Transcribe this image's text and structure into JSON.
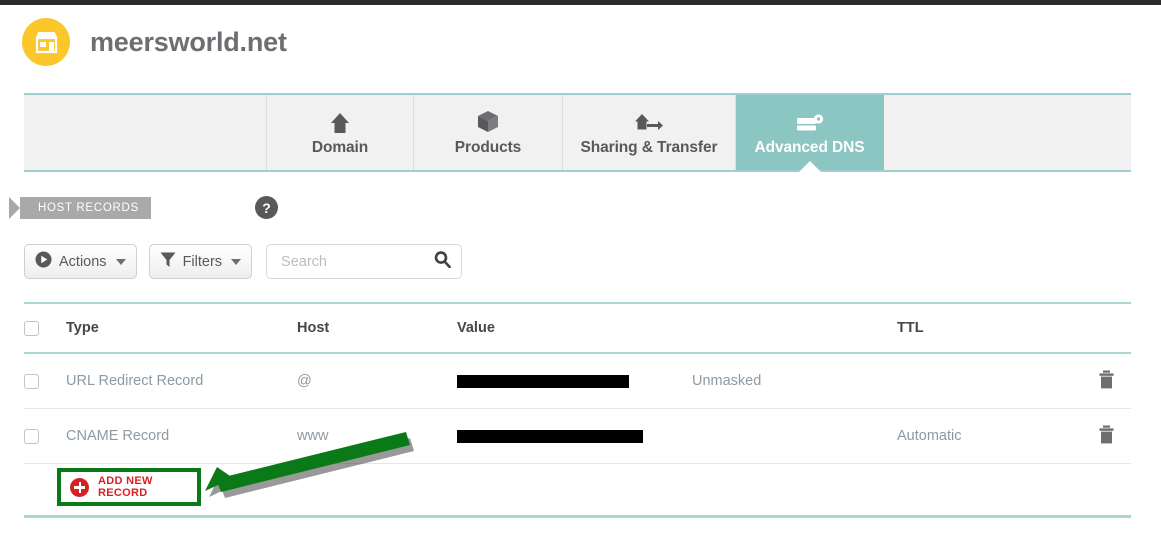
{
  "brand": {
    "domain_name": "meersworld.net",
    "logo_icon": "storefront-icon",
    "logo_color": "#fbc72b"
  },
  "tabs": {
    "active": "Advanced DNS",
    "active_color": "#8cc6c3",
    "items": [
      {
        "label": "",
        "icon": ""
      },
      {
        "label": "Domain",
        "icon": "house-icon"
      },
      {
        "label": "Products",
        "icon": "box-icon"
      },
      {
        "label": "Sharing & Transfer",
        "icon": "house-arrow-icon"
      },
      {
        "label": "Advanced DNS",
        "icon": "server-gear-icon"
      }
    ]
  },
  "section": {
    "ribbon_label": "HOST RECORDS",
    "ribbon_color": "#a7a9ab",
    "help_icon": "question-mark-icon",
    "help_label": "?"
  },
  "toolbar": {
    "actions_label": "Actions",
    "actions_icon": "play-circle-icon",
    "filters_label": "Filters",
    "filters_icon": "funnel-icon",
    "search_value": "",
    "search_placeholder": "Search",
    "search_icon": "magnifier-icon"
  },
  "table": {
    "headers": {
      "type": "Type",
      "host": "Host",
      "value": "Value",
      "ttl": "TTL"
    },
    "rows": [
      {
        "type": "URL Redirect Record",
        "host": "@",
        "value": "",
        "value_redacted": true,
        "value_redact_width": 172,
        "extra": "Unmasked",
        "ttl": "",
        "delete_icon": "trash-icon"
      },
      {
        "type": "CNAME Record",
        "host": "www",
        "value": "",
        "value_redacted": true,
        "value_redact_width": 186,
        "extra": "",
        "ttl": "Automatic",
        "delete_icon": "trash-icon"
      }
    ]
  },
  "add_record": {
    "label": "ADD NEW RECORD",
    "icon": "plus-circle-icon",
    "text_color": "#d91f26",
    "highlight_color": "#0a7a18"
  },
  "annotation": {
    "arrow_color": "#0a7a18",
    "arrow_type": "pointer-arrow",
    "points_to": "ADD NEW RECORD"
  }
}
